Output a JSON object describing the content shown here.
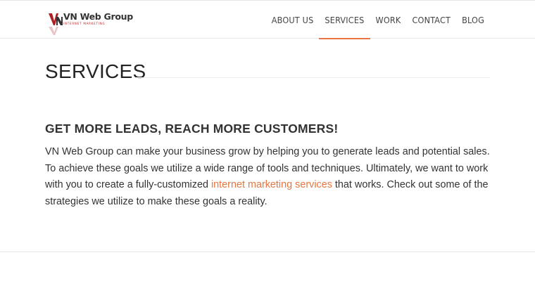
{
  "brand": {
    "name": "VN Web Group",
    "tagline": "INTERNET MARKETING",
    "mark_color": "#b01e23"
  },
  "nav": {
    "items": [
      {
        "label": "ABOUT US",
        "active": false
      },
      {
        "label": "SERVICES",
        "active": true
      },
      {
        "label": "WORK",
        "active": false
      },
      {
        "label": "CONTACT",
        "active": false
      },
      {
        "label": "BLOG",
        "active": false
      }
    ]
  },
  "page": {
    "title": "SERVICES",
    "subheading": "GET MORE LEADS, REACH MORE CUSTOMERS!",
    "intro_before_link": "VN Web Group can make your business grow by helping you to generate leads and potential sales. To achieve these goals we utilize a wide range of tools and techniques. Ultimately, we want to work with you to create a fully-customized ",
    "intro_link": "internet marketing services",
    "intro_after_link": " that works. Check out some of the strategies we utilize to make these goals a reality."
  },
  "colors": {
    "accent": "#e8753f",
    "text": "#333333"
  }
}
